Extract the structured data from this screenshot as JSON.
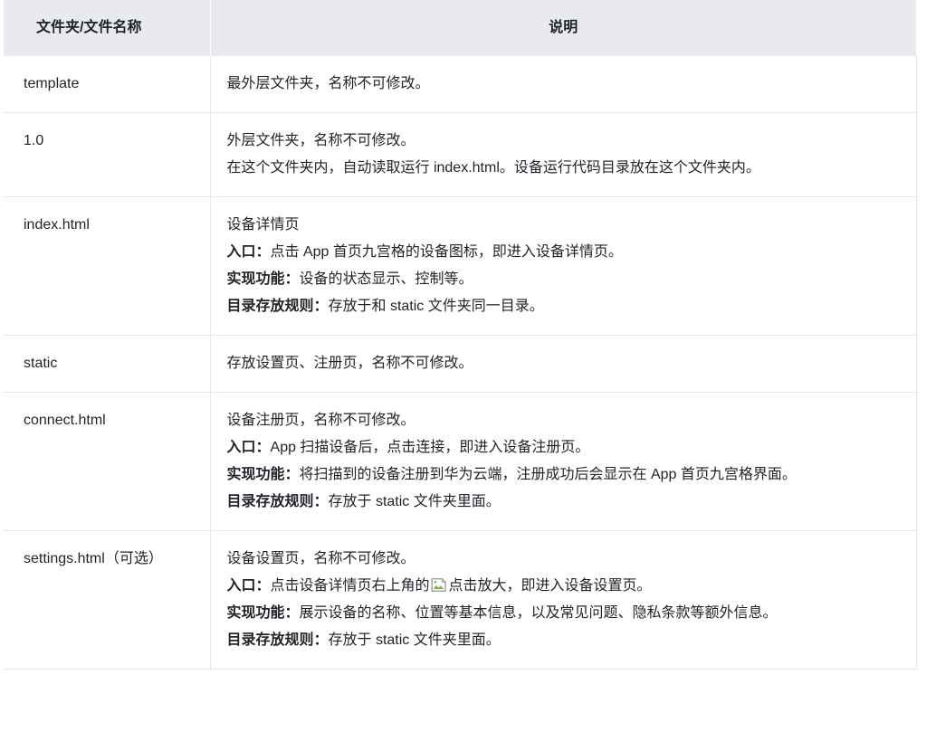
{
  "table": {
    "headers": {
      "name": "文件夹/文件名称",
      "description": "说明"
    },
    "rows": [
      {
        "name": "template",
        "lines": [
          {
            "label": "",
            "text": "最外层文件夹，名称不可修改。"
          }
        ]
      },
      {
        "name": "1.0",
        "lines": [
          {
            "label": "",
            "text": "外层文件夹，名称不可修改。"
          },
          {
            "label": "",
            "text": "在这个文件夹内，自动读取运行 index.html。设备运行代码目录放在这个文件夹内。"
          }
        ]
      },
      {
        "name": "index.html",
        "lines": [
          {
            "label": "",
            "text": "设备详情页"
          },
          {
            "label": "入口：",
            "text": "点击 App 首页九宫格的设备图标，即进入设备详情页。"
          },
          {
            "label": "实现功能：",
            "text": "设备的状态显示、控制等。"
          },
          {
            "label": "目录存放规则：",
            "text": "存放于和 static 文件夹同一目录。"
          }
        ]
      },
      {
        "name": "static",
        "lines": [
          {
            "label": "",
            "text": "存放设置页、注册页，名称不可修改。"
          }
        ]
      },
      {
        "name": "connect.html",
        "lines": [
          {
            "label": "",
            "text": "设备注册页，名称不可修改。"
          },
          {
            "label": "入口：",
            "text": "App 扫描设备后，点击连接，即进入设备注册页。"
          },
          {
            "label": "实现功能：",
            "text": "将扫描到的设备注册到华为云端，注册成功后会显示在 App 首页九宫格界面。"
          },
          {
            "label": "目录存放规则：",
            "text": "存放于 static 文件夹里面。"
          }
        ]
      },
      {
        "name": "settings.html（可选）",
        "lines": [
          {
            "label": "",
            "text": "设备设置页，名称不可修改。"
          },
          {
            "label": "入口：",
            "text": "点击设备详情页右上角的",
            "icon": "broken-image-icon",
            "text_after": "点击放大，即进入设备设置页。"
          },
          {
            "label": "实现功能：",
            "text": "展示设备的名称、位置等基本信息，以及常见问题、隐私条款等额外信息。"
          },
          {
            "label": "目录存放规则：",
            "text": "存放于 static 文件夹里面。"
          }
        ]
      }
    ]
  },
  "colors": {
    "header_background": "#e8eaed",
    "text": "#1f2329",
    "border": "#e5e6eb",
    "page_background": "#ffffff",
    "icon_green": "#7ab648"
  }
}
